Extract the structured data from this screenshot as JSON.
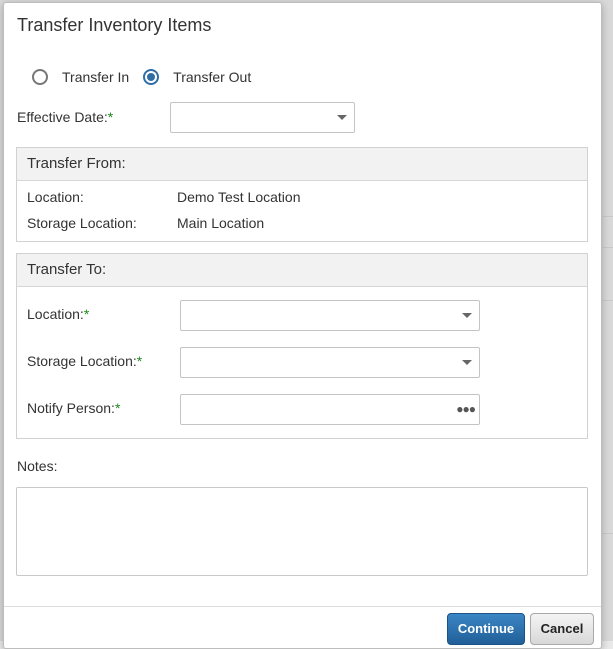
{
  "dialog": {
    "title": "Transfer Inventory Items"
  },
  "transfer_type": {
    "options": [
      {
        "label": "Transfer In",
        "checked": false
      },
      {
        "label": "Transfer Out",
        "checked": true
      }
    ]
  },
  "effective_date": {
    "label": "Effective Date:",
    "required_mark": "*",
    "value": ""
  },
  "transfer_from": {
    "heading": "Transfer From:",
    "location_label": "Location:",
    "location_value": "Demo Test Location",
    "storage_label": "Storage Location:",
    "storage_value": "Main Location"
  },
  "transfer_to": {
    "heading": "Transfer To:",
    "location_label": "Location:",
    "storage_label": "Storage Location:",
    "notify_label": "Notify Person:",
    "required_mark": "*",
    "location_value": "",
    "storage_value": "",
    "notify_value": ""
  },
  "notes": {
    "label": "Notes:",
    "value": ""
  },
  "buttons": {
    "continue": "Continue",
    "cancel": "Cancel"
  },
  "colors": {
    "accent": "#2e6ea5",
    "required": "#1b8a1b"
  }
}
